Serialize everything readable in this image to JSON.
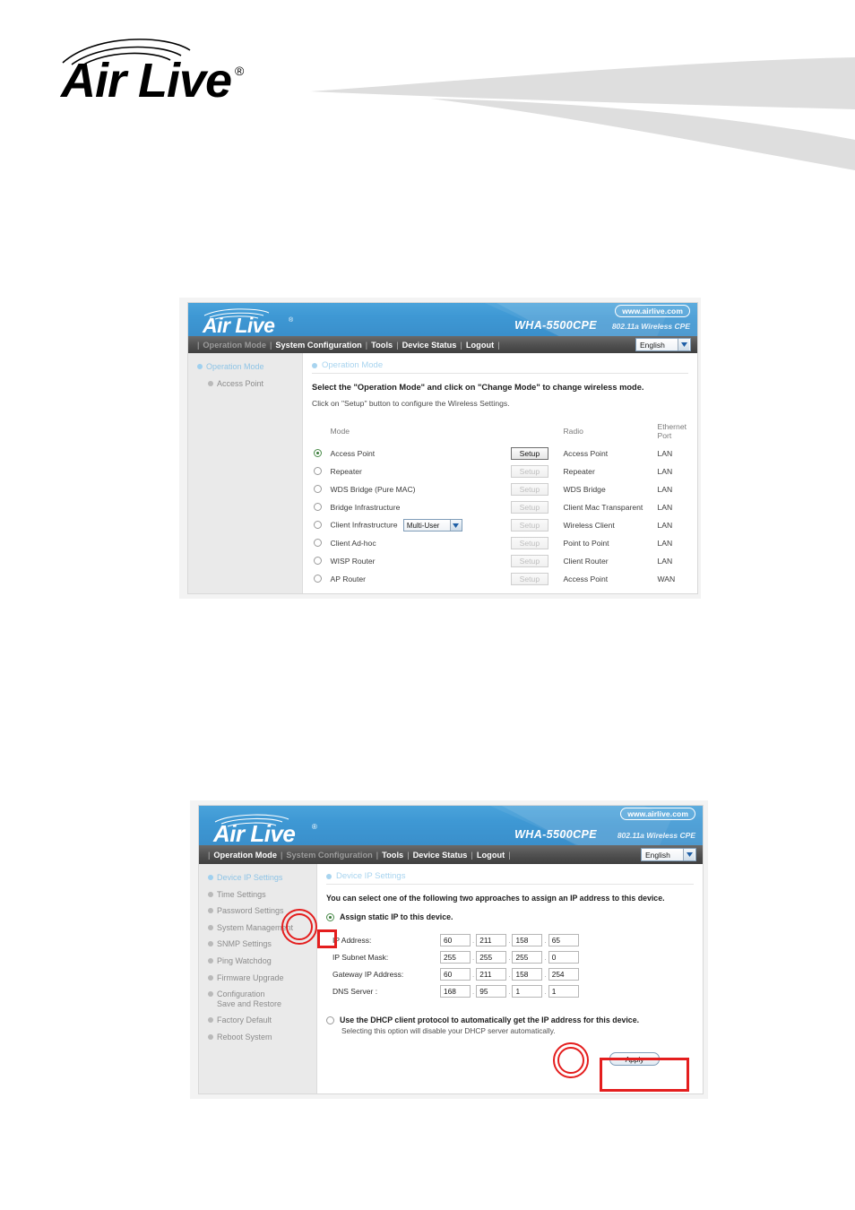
{
  "page": {
    "brand_name": "Air Live",
    "brand_registered_mark": "®"
  },
  "screenshot_one": {
    "banner": {
      "url_badge": "www.airlive.com",
      "model": "WHA-5500CPE",
      "subtitle": "802.11a Wireless CPE"
    },
    "nav": {
      "items": [
        {
          "label": "Operation Mode",
          "active": true
        },
        {
          "label": "System Configuration",
          "active": false
        },
        {
          "label": "Tools",
          "active": false
        },
        {
          "label": "Device Status",
          "active": false
        },
        {
          "label": "Logout",
          "active": false
        }
      ],
      "language": "English"
    },
    "sidebar": {
      "heading": "Operation Mode",
      "items": [
        {
          "label": "Access Point"
        }
      ]
    },
    "main": {
      "title": "Operation Mode",
      "lead_bold": "Select the \"Operation Mode\" and click on \"Change Mode\" to change wireless mode.",
      "lead_normal": "Click on \"Setup\" button to configure the Wireless Settings.",
      "table": {
        "headers": [
          "Mode",
          "Radio",
          "Ethernet Port"
        ],
        "setup_label": "Setup",
        "rows": [
          {
            "mode": "Access Point",
            "selected": true,
            "setup_enabled": true,
            "radio": "Access Point",
            "ethernet": "LAN",
            "dropdown": null
          },
          {
            "mode": "Repeater",
            "selected": false,
            "setup_enabled": false,
            "radio": "Repeater",
            "ethernet": "LAN",
            "dropdown": null
          },
          {
            "mode": "WDS Bridge (Pure MAC)",
            "selected": false,
            "setup_enabled": false,
            "radio": "WDS Bridge",
            "ethernet": "LAN",
            "dropdown": null
          },
          {
            "mode": "Bridge Infrastructure",
            "selected": false,
            "setup_enabled": false,
            "radio": "Client Mac Transparent",
            "ethernet": "LAN",
            "dropdown": null
          },
          {
            "mode": "Client Infrastructure",
            "selected": false,
            "setup_enabled": false,
            "radio": "Wireless Client",
            "ethernet": "LAN",
            "dropdown": "Multi-User"
          },
          {
            "mode": "Client Ad-hoc",
            "selected": false,
            "setup_enabled": false,
            "radio": "Point to Point",
            "ethernet": "LAN",
            "dropdown": null
          },
          {
            "mode": "WISP Router",
            "selected": false,
            "setup_enabled": false,
            "radio": "Client Router",
            "ethernet": "LAN",
            "dropdown": null
          },
          {
            "mode": "AP Router",
            "selected": false,
            "setup_enabled": false,
            "radio": "Access Point",
            "ethernet": "WAN",
            "dropdown": null
          }
        ]
      }
    }
  },
  "screenshot_two": {
    "banner": {
      "url_badge": "www.airlive.com",
      "model": "WHA-5500CPE",
      "subtitle": "802.11a Wireless CPE"
    },
    "nav": {
      "items": [
        {
          "label": "Operation Mode",
          "active": false
        },
        {
          "label": "System Configuration",
          "active": true
        },
        {
          "label": "Tools",
          "active": false
        },
        {
          "label": "Device Status",
          "active": false
        },
        {
          "label": "Logout",
          "active": false
        }
      ],
      "language": "English"
    },
    "sidebar": {
      "items": [
        {
          "label": "Device IP Settings",
          "active": true
        },
        {
          "label": "Time Settings",
          "active": false
        },
        {
          "label": "Password Settings",
          "active": false
        },
        {
          "label": "System Management",
          "active": false
        },
        {
          "label": "SNMP Settings",
          "active": false
        },
        {
          "label": "Ping Watchdog",
          "active": false
        },
        {
          "label": "Firmware Upgrade",
          "active": false
        },
        {
          "label": "Configuration\nSave and Restore",
          "active": false
        },
        {
          "label": "Factory Default",
          "active": false
        },
        {
          "label": "Reboot System",
          "active": false
        }
      ]
    },
    "main": {
      "title": "Device IP Settings",
      "lead": "You can select one of the following two approaches to assign an IP address to this device.",
      "static_option": {
        "label": "Assign static IP to this device.",
        "selected": true
      },
      "fields": [
        {
          "label": "IP Address:",
          "octets": [
            "60",
            "211",
            "158",
            "65"
          ]
        },
        {
          "label": "IP Subnet Mask:",
          "octets": [
            "255",
            "255",
            "255",
            "0"
          ]
        },
        {
          "label": "Gateway IP Address:",
          "octets": [
            "60",
            "211",
            "158",
            "254"
          ]
        },
        {
          "label": "DNS Server :",
          "octets": [
            "168",
            "95",
            "1",
            "1"
          ]
        }
      ],
      "dhcp_option": {
        "label": "Use the DHCP client protocol to automatically get the IP address for this device.",
        "sub": "Selecting this option will disable your DHCP server automatically.",
        "selected": false
      },
      "apply_label": "Apply"
    }
  }
}
